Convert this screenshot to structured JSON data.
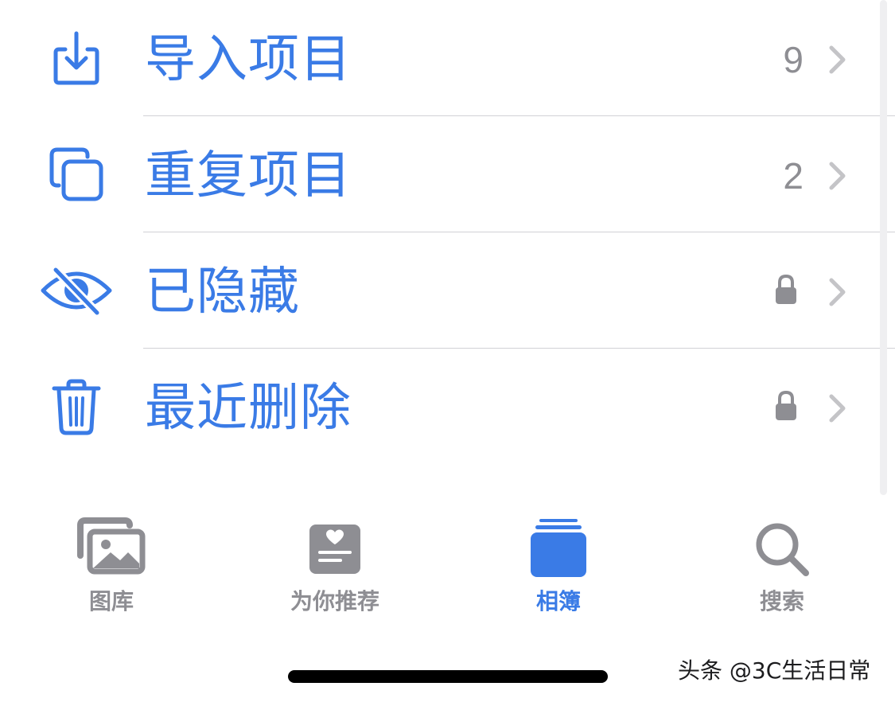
{
  "colors": {
    "accent": "#3a7be6",
    "secondary_text": "#8e8e93",
    "chevron": "#c4c4c7",
    "separator": "#d1d1d6"
  },
  "albums_list": {
    "items": [
      {
        "label": "导入项目",
        "count": "9",
        "icon": "import-icon"
      },
      {
        "label": "重复项目",
        "count": "2",
        "icon": "duplicate-icon"
      },
      {
        "label": "已隐藏",
        "icon": "hidden-eye-icon",
        "locked": true
      },
      {
        "label": "最近删除",
        "icon": "trash-icon",
        "locked": true
      }
    ]
  },
  "tab_bar": {
    "tabs": [
      {
        "label": "图库",
        "icon": "photos-library-icon",
        "active": false
      },
      {
        "label": "为你推荐",
        "icon": "for-you-icon",
        "active": false
      },
      {
        "label": "相簿",
        "icon": "albums-icon",
        "active": true
      },
      {
        "label": "搜索",
        "icon": "search-icon",
        "active": false
      }
    ]
  },
  "watermark": "头条 @3C生活日常"
}
